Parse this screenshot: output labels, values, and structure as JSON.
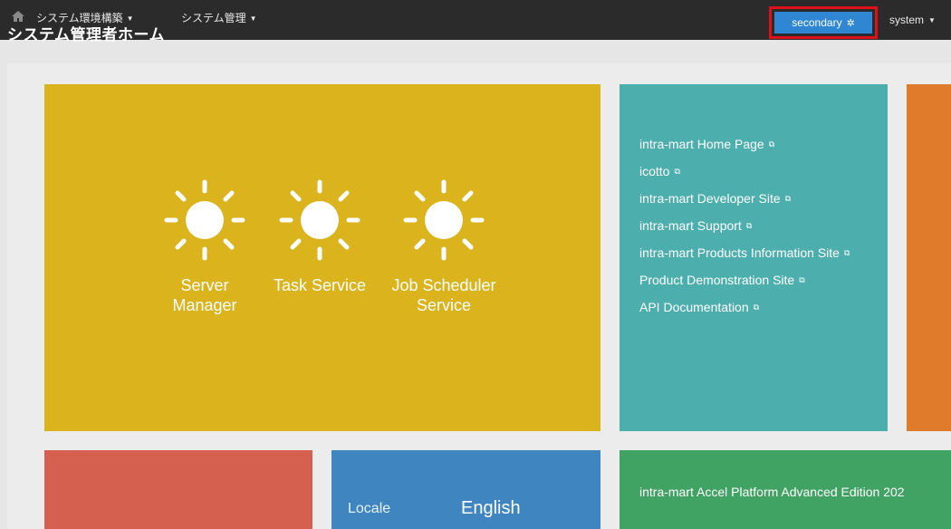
{
  "header": {
    "home_icon": "home-icon",
    "menu1_label": "システム環境構築",
    "menu2_label": "システム管理",
    "page_title": "システム管理者ホーム",
    "secondary_label": "secondary",
    "user_label": "system"
  },
  "services": [
    {
      "label": "Server Manager",
      "icon": "sun-icon"
    },
    {
      "label": "Task Service",
      "icon": "sun-icon"
    },
    {
      "label": "Job Scheduler Service",
      "icon": "sun-icon"
    }
  ],
  "links": [
    "intra-mart Home Page",
    "icotto",
    "intra-mart Developer Site",
    "intra-mart Support",
    "intra-mart Products Information Site",
    "Product Demonstration Site",
    "API Documentation"
  ],
  "locale": {
    "label": "Locale",
    "value": "English"
  },
  "edition": "intra-mart Accel Platform Advanced Edition 202",
  "colors": {
    "topbar": "#2b2b2b",
    "secondary_button": "#2f86d3",
    "highlight_border": "#e0101a",
    "tile_yellow": "#dbb31c",
    "tile_teal": "#4cafae",
    "tile_orange": "#e07b2c",
    "tile_red": "#d6604f",
    "tile_blue": "#3f86c0",
    "tile_green": "#40a263"
  }
}
